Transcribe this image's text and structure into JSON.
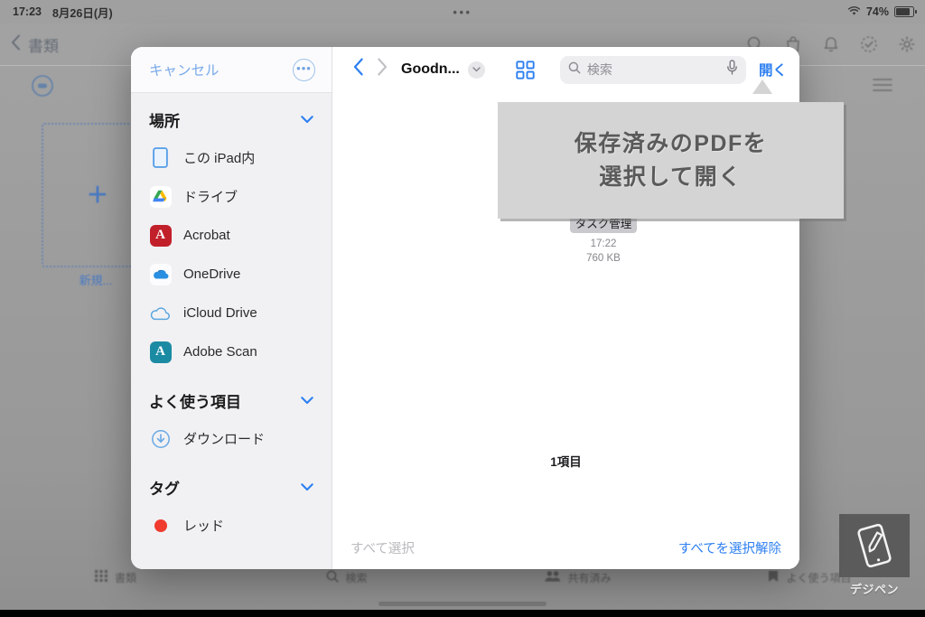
{
  "status_bar": {
    "time": "17:23",
    "date": "8月26日(月)",
    "center_dots": "•••",
    "battery_percent": "74%",
    "wifi_icon": "wifi-icon",
    "battery_icon": "battery-icon"
  },
  "background_app": {
    "back_label": "書類",
    "back_icon": "chevron-left-icon",
    "title": "",
    "top_icons": [
      "search-icon",
      "bag-icon",
      "bell-icon",
      "check-circle-icon",
      "gear-icon"
    ],
    "sidebar_icon": "document-badge-icon",
    "new_doc_plus": "+",
    "new_doc_label": "新規...",
    "list_icon": "list-icon",
    "tabs": [
      {
        "label": "書類",
        "icon": "grid-icon"
      },
      {
        "label": "検索",
        "icon": "search-icon"
      },
      {
        "label": "共有済み",
        "icon": "people-icon"
      },
      {
        "label": "よく使う項目",
        "icon": "bookmark-icon"
      }
    ]
  },
  "picker": {
    "sidebar": {
      "cancel_label": "キャンセル",
      "more_icon": "ellipsis-circle-icon",
      "sections": [
        {
          "title": "場所",
          "chevron_icon": "chevron-down-icon",
          "items": [
            {
              "label": "この iPad内",
              "icon": "ipad-icon",
              "color": "#4a90e2"
            },
            {
              "label": "ドライブ",
              "icon": "google-drive-icon",
              "color": "#ffffff"
            },
            {
              "label": "Acrobat",
              "icon": "acrobat-icon",
              "color": "#c1202a"
            },
            {
              "label": "OneDrive",
              "icon": "onedrive-icon",
              "color": "#ffffff"
            },
            {
              "label": "iCloud Drive",
              "icon": "icloud-icon",
              "color": "#5ba6e0"
            },
            {
              "label": "Adobe Scan",
              "icon": "adobe-scan-icon",
              "color": "#1b8ba3"
            }
          ]
        },
        {
          "title": "よく使う項目",
          "chevron_icon": "chevron-down-icon",
          "items": [
            {
              "label": "ダウンロード",
              "icon": "download-circle-icon",
              "color": "#5ba6e0"
            }
          ]
        },
        {
          "title": "タグ",
          "chevron_icon": "chevron-down-icon",
          "items": [
            {
              "label": "レッド",
              "icon": "red-dot-icon",
              "color": "#f03b2e"
            }
          ]
        }
      ]
    },
    "toolbar": {
      "back_icon": "chevron-left-icon",
      "forward_icon": "chevron-right-icon",
      "folder_name": "Goodn...",
      "folder_chevron_icon": "chevron-down-icon",
      "view_icon": "grid-view-icon",
      "search_icon": "search-icon",
      "search_placeholder": "検索",
      "search_value": "",
      "mic_icon": "microphone-icon",
      "open_label": "開く"
    },
    "files": [
      {
        "name": "タスク管理",
        "time": "17:22",
        "size": "760 KB",
        "selected": true,
        "check_icon": "check-circle-icon"
      }
    ],
    "count_label": "1項目",
    "footer": {
      "select_all_label": "すべて選択",
      "deselect_all_label": "すべてを選択解除"
    }
  },
  "callout": {
    "line1": "保存済みのPDFを",
    "line2": "選択して開く",
    "background_color": "#d4d4d4",
    "text_color": "#5a5a5a"
  },
  "watermark": {
    "label": "デジペン",
    "icon": "tablet-pen-icon"
  },
  "colors": {
    "accent_blue": "#2d7ff0",
    "sidebar_bg": "#f1f1f4",
    "sheet_bg": "#ffffff",
    "disabled_gray": "#b9b9be"
  }
}
